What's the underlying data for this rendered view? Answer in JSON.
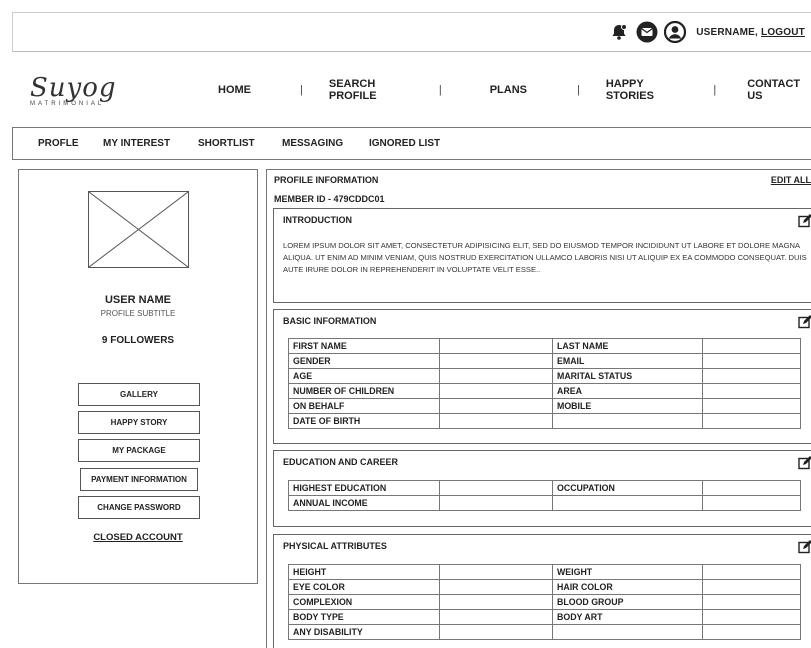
{
  "topbar": {
    "icons": [
      "notification-bell-icon",
      "mail-icon",
      "user-avatar-icon"
    ],
    "username": "USERNAME,",
    "logout": "LOGOUT"
  },
  "brand": {
    "name": "Suyog",
    "tagline": "MATRIMONIAL"
  },
  "nav": {
    "items": [
      "HOME",
      "SEARCH PROFILE",
      "PLANS",
      "HAPPY STORIES",
      "CONTACT US"
    ],
    "separator": "|"
  },
  "tabs": [
    "PROFLE",
    "MY INTEREST",
    "SHORTLIST",
    "MESSAGING",
    "IGNORED LIST"
  ],
  "sidebar": {
    "user_name": "USER NAME",
    "subtitle": "PROFILE SUBTITLE",
    "followers": "9 FOLLOWERS",
    "buttons": [
      "GALLERY",
      "HAPPY STORY",
      "MY PACKAGE",
      "PAYMENT INFORMATION",
      "CHANGE PASSWORD"
    ],
    "closed_account": "CLOSED ACCOUNT"
  },
  "profile": {
    "title": "PROFILE INFORMATION",
    "member_id": "MEMBER ID - 479CDDC01",
    "edit_all": "EDIT ALL",
    "introduction": {
      "title": "INTRODUCTION",
      "text": "LOREM IPSUM DOLOR SIT AMET, CONSECTETUR ADIPISICING ELIT, SED DO EIUSMOD TEMPOR INCIDIDUNT UT LABORE ET DOLORE MAGNA ALIQUA. UT ENIM AD MINIM VENIAM, QUIS NOSTRUD EXERCITATION ULLAMCO LABORIS NISI UT ALIQUIP EX EA COMMODO CONSEQUAT. DUIS AUTE IRURE DOLOR IN REPREHENDERIT IN VOLUPTATE VELIT ESSE.."
    },
    "basic": {
      "title": "BASIC INFORMATION",
      "rows": [
        [
          "FIRST NAME",
          "",
          "LAST NAME",
          ""
        ],
        [
          "GENDER",
          "",
          "EMAIL",
          ""
        ],
        [
          "AGE",
          "",
          "MARITAL STATUS",
          ""
        ],
        [
          "NUMBER OF CHILDREN",
          "",
          "AREA",
          ""
        ],
        [
          "ON BEHALF",
          "",
          "MOBILE",
          ""
        ],
        [
          "DATE OF BIRTH",
          "",
          "",
          ""
        ]
      ]
    },
    "education": {
      "title": "EDUCATION AND CAREER",
      "rows": [
        [
          "HIGHEST EDUCATION",
          "",
          "OCCUPATION",
          ""
        ],
        [
          "ANNUAL INCOME",
          "",
          "",
          ""
        ]
      ]
    },
    "physical": {
      "title": "PHYSICAL ATTRIBUTES",
      "rows": [
        [
          "HEIGHT",
          "",
          "WEIGHT",
          ""
        ],
        [
          "EYE COLOR",
          "",
          "HAIR COLOR",
          ""
        ],
        [
          "COMPLEXION",
          "",
          "BLOOD GROUP",
          ""
        ],
        [
          "BODY TYPE",
          "",
          "BODY ART",
          ""
        ],
        [
          "ANY DISABILITY",
          "",
          "",
          ""
        ]
      ]
    }
  }
}
